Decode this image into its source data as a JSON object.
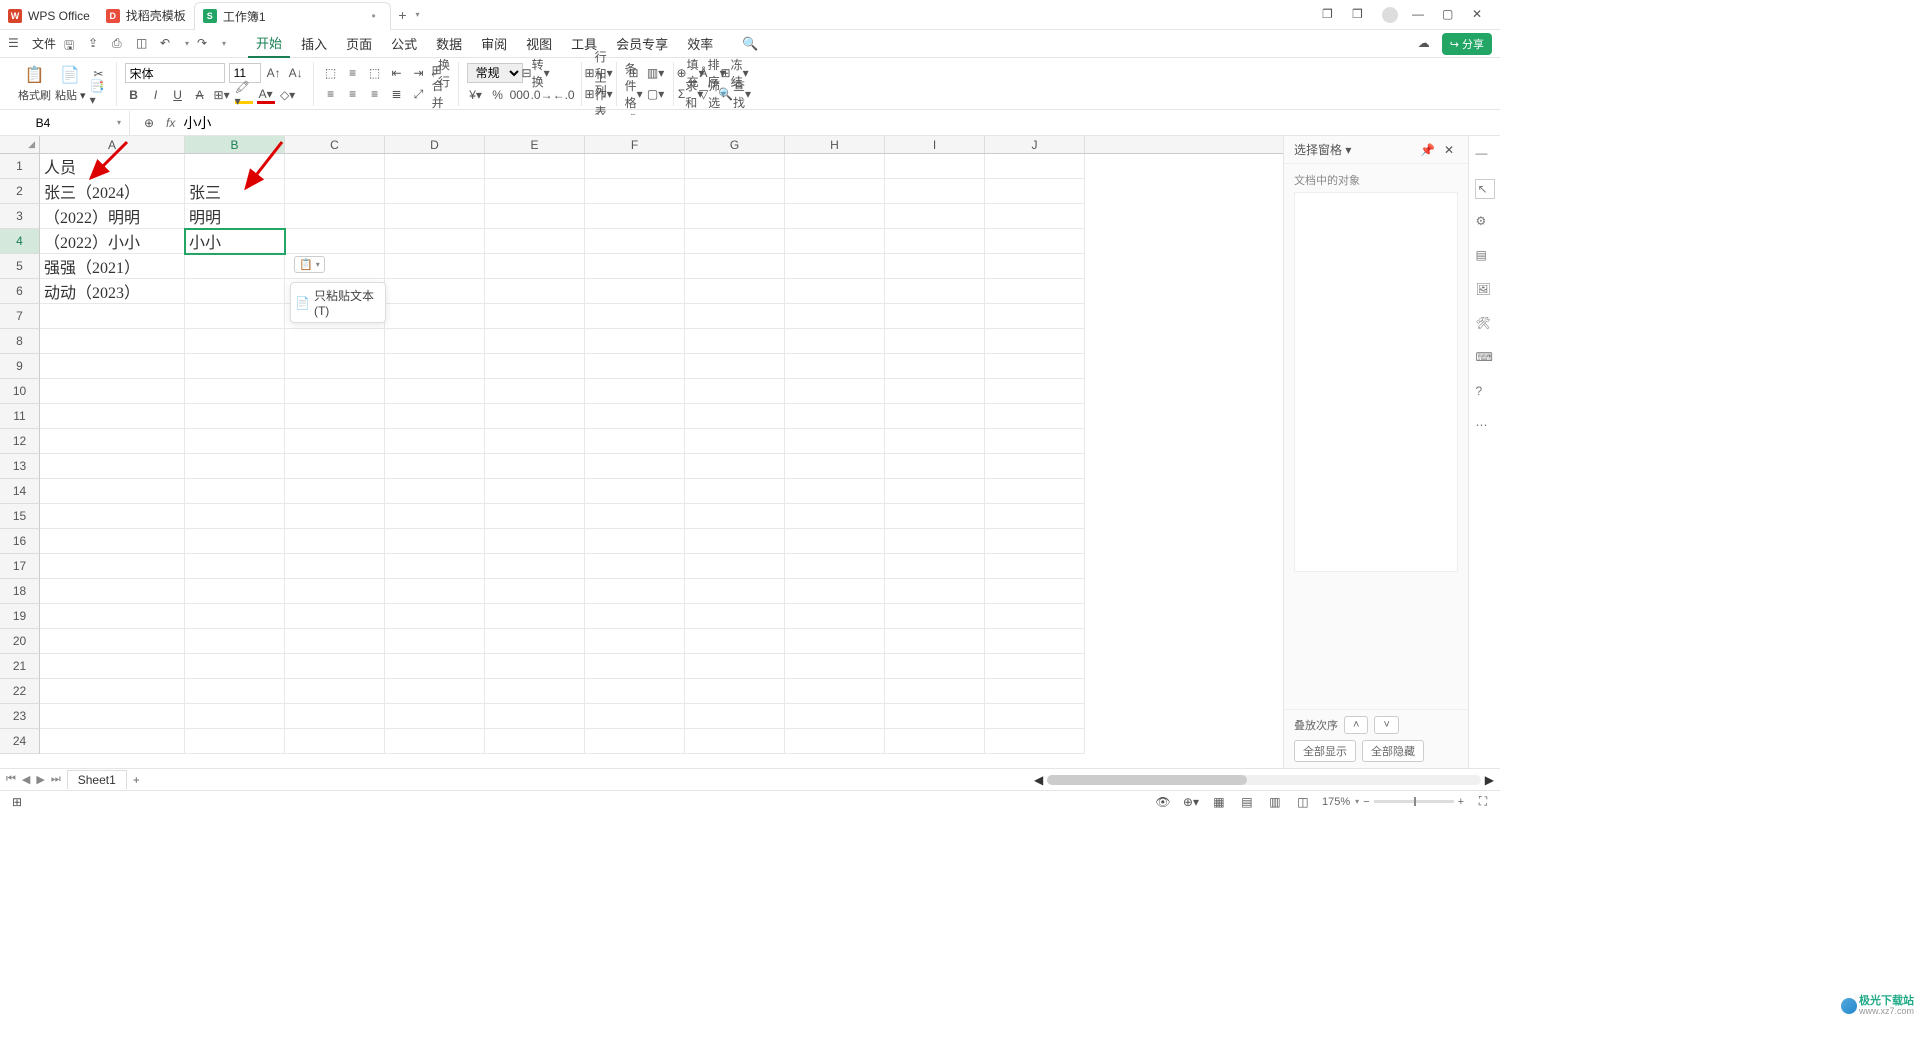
{
  "titlebar": {
    "tabs": [
      {
        "icon_bg": "#d9452b",
        "icon_text": "W",
        "label": "WPS Office"
      },
      {
        "icon_bg": "#e94e3c",
        "icon_text": "D",
        "label": "找稻壳模板"
      },
      {
        "icon_bg": "#22a565",
        "icon_text": "S",
        "label": "工作簿1"
      }
    ],
    "add": "+"
  },
  "menubar": {
    "file": "文件",
    "tabs": [
      "开始",
      "插入",
      "页面",
      "公式",
      "数据",
      "审阅",
      "视图",
      "工具",
      "会员专享",
      "效率"
    ],
    "share": "分享"
  },
  "ribbon": {
    "format_painter": "格式刷",
    "paste": "粘贴",
    "font_name": "宋体",
    "font_size": "11",
    "wrap": "换行",
    "number_fmt": "常规",
    "convert": "转换",
    "rowcol": "行和列",
    "worksheet": "工作表",
    "cond_fmt": "条件格式",
    "fill": "填充",
    "sort": "排序",
    "freeze": "冻结",
    "sum": "求和",
    "filter": "筛选",
    "find": "查找"
  },
  "formula": {
    "namebox": "B4",
    "content": "小小"
  },
  "grid": {
    "cols": [
      "A",
      "B",
      "C",
      "D",
      "E",
      "F",
      "G",
      "H",
      "I",
      "J"
    ],
    "rows_count": 24,
    "selected_row": 4,
    "selected_col": "B",
    "data": {
      "A1": "人员",
      "A2": "张三（2024）",
      "A3": "（2022）明明",
      "A4": "（2022）小小",
      "A5": "强强（2021）",
      "A6": "动动（2023）",
      "B2": "张三",
      "B3": "明明",
      "B4": "小小"
    }
  },
  "paste_options": {
    "label": "只粘贴文本(T)"
  },
  "side": {
    "title": "选择窗格",
    "subtitle": "文档中的对象",
    "stack_order": "叠放次序",
    "show_all": "全部显示",
    "hide_all": "全部隐藏"
  },
  "sheets": {
    "name": "Sheet1"
  },
  "status": {
    "zoom": "175%"
  },
  "watermark": {
    "t1": "极光下载站",
    "t2": "www.xz7.com"
  }
}
